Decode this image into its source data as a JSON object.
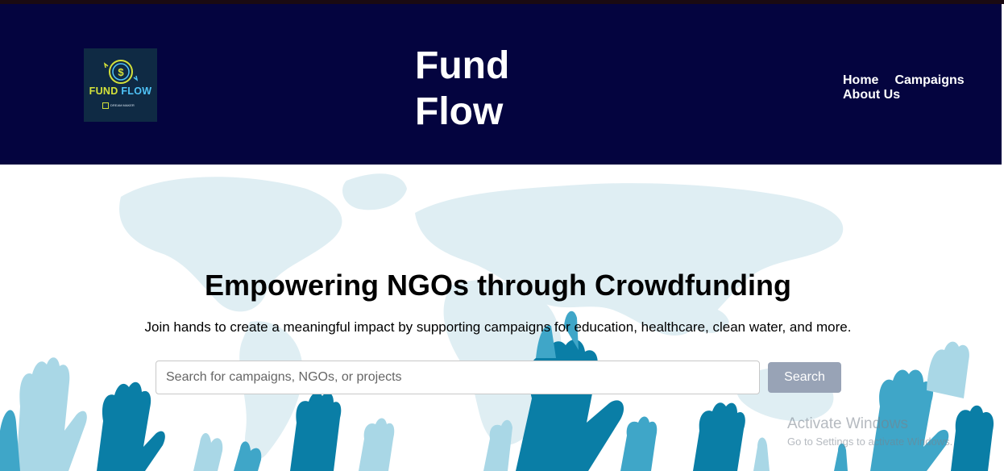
{
  "header": {
    "logo": {
      "word1": "FUND",
      "word2": "FLOW",
      "tagline": "DREAM MAKER",
      "icon": "dollar-coin-icon"
    },
    "title_line1": "Fund",
    "title_line2": "Flow",
    "nav": [
      "Home",
      "Campaigns",
      "About Us"
    ]
  },
  "hero": {
    "heading": "Empowering NGOs through Crowdfunding",
    "subheading": "Join hands to create a meaningful impact by supporting campaigns for education, healthcare, clean water, and more.",
    "search": {
      "placeholder": "Search for campaigns, NGOs, or projects",
      "value": "",
      "button_label": "Search"
    },
    "background": "world-map-with-raised-hands"
  },
  "watermark": {
    "title": "Activate Windows",
    "subtitle": "Go to Settings to activate Windows."
  },
  "colors": {
    "header_bg": "#04043f",
    "search_button_bg": "#98a3b6",
    "map": "#dfeef3",
    "hand_light": "#a9d7e6",
    "hand_mid": "#3fa6c8",
    "hand_dark": "#0a7ea6"
  }
}
